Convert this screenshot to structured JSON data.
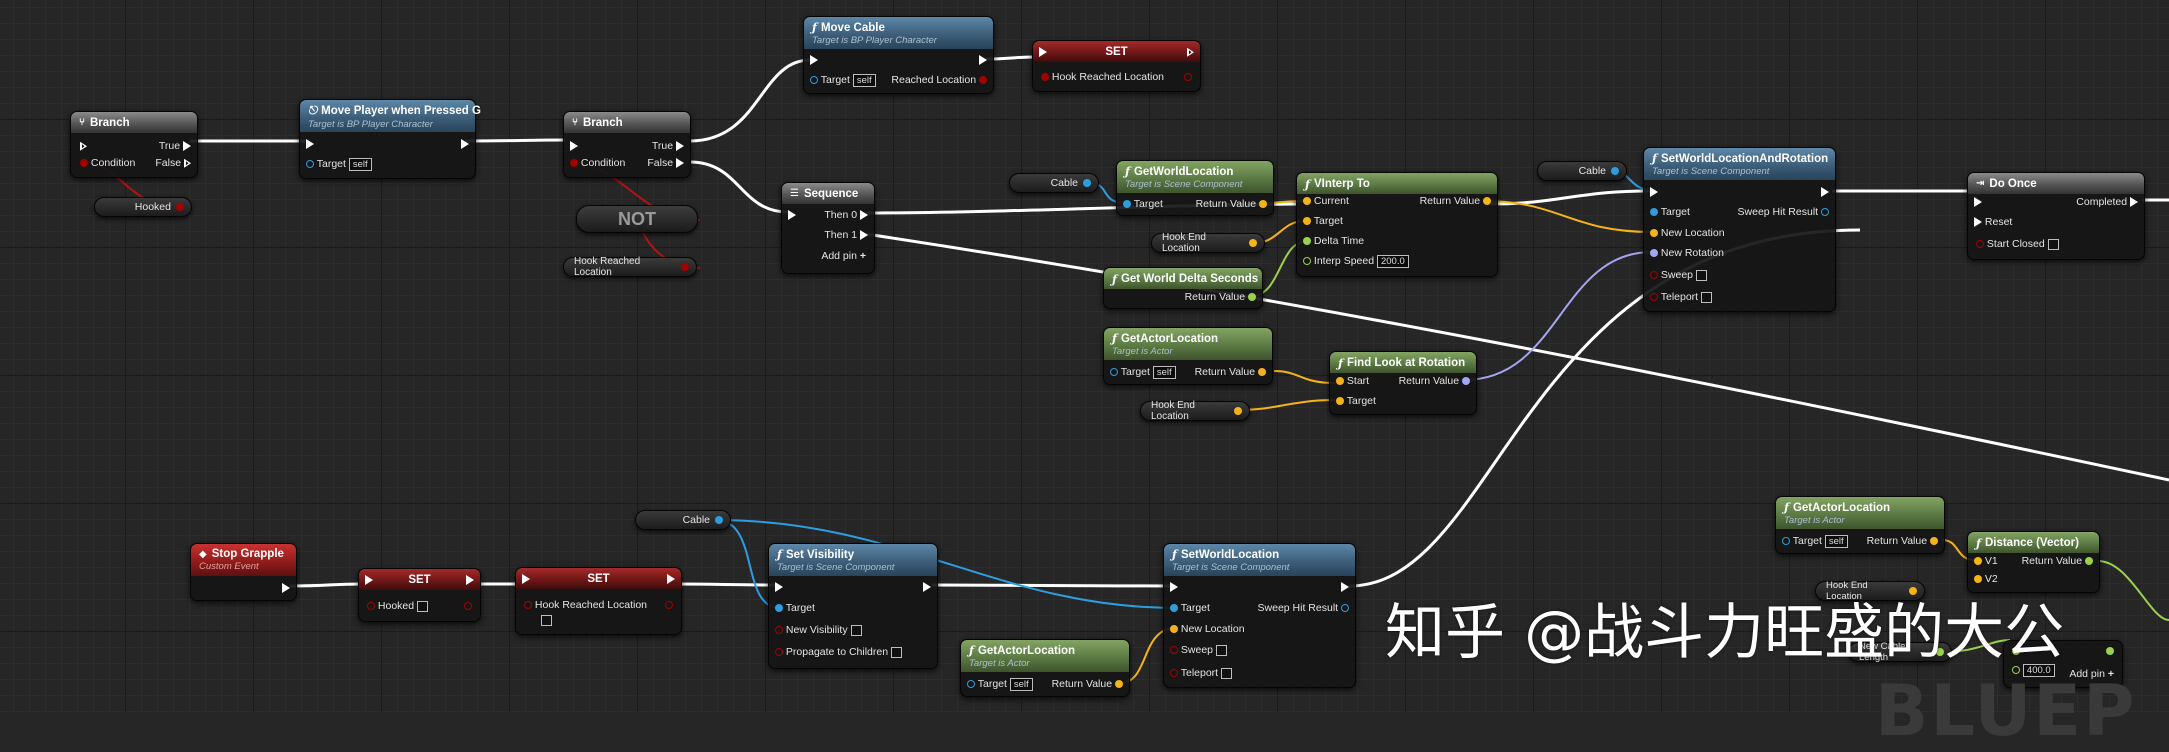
{
  "colors": {
    "exec": "#ffffff",
    "object": "#2e9de0",
    "vector": "#f5b31a",
    "float": "#9bd24c",
    "rotator": "#a3a6f0",
    "bool": "#a30000",
    "struct": "#7aa0ff"
  },
  "nodes": {
    "branch1": {
      "title": "Branch",
      "condition": "Condition",
      "true": "True",
      "false": "False"
    },
    "hooked_get": {
      "label": "Hooked"
    },
    "move_player": {
      "title": "Move Player when Pressed G",
      "subtitle": "Target is BP Player Character",
      "target": "Target",
      "self": "self"
    },
    "branch2": {
      "title": "Branch",
      "condition": "Condition",
      "true": "True",
      "false": "False"
    },
    "not_node": {
      "label": "NOT"
    },
    "hook_reached_get": {
      "label": "Hook Reached Location"
    },
    "move_cable": {
      "title": "Move Cable",
      "subtitle": "Target is BP Player Character",
      "target": "Target",
      "self": "self",
      "out": "Reached Location"
    },
    "set_top": {
      "title": "SET",
      "pin": "Hook Reached Location"
    },
    "sequence": {
      "title": "Sequence",
      "then0": "Then 0",
      "then1": "Then 1",
      "add": "Add pin"
    },
    "cable_get1": {
      "label": "Cable"
    },
    "get_world_location": {
      "title": "GetWorldLocation",
      "subtitle": "Target is Scene Component",
      "target": "Target",
      "ret": "Return Value"
    },
    "vinterp": {
      "title": "VInterp To",
      "current": "Current",
      "target": "Target",
      "delta": "Delta Time",
      "speed": "Interp Speed",
      "speed_val": "200.0",
      "ret": "Return Value"
    },
    "hook_end_get1": {
      "label": "Hook End Location"
    },
    "get_delta": {
      "title": "Get World Delta Seconds",
      "ret": "Return Value"
    },
    "cable_get2": {
      "label": "Cable"
    },
    "set_wlr": {
      "title": "SetWorldLocationAndRotation",
      "subtitle": "Target is Scene Component",
      "target": "Target",
      "newloc": "New Location",
      "newrot": "New Rotation",
      "sweep": "Sweep",
      "teleport": "Teleport",
      "ret": "Sweep Hit Result"
    },
    "get_actor_loc1": {
      "title": "GetActorLocation",
      "subtitle": "Target is Actor",
      "target": "Target",
      "self": "self",
      "ret": "Return Value"
    },
    "find_look": {
      "title": "Find Look at Rotation",
      "start": "Start",
      "target": "Target",
      "ret": "Return Value"
    },
    "hook_end_get2": {
      "label": "Hook End Location"
    },
    "do_once": {
      "title": "Do Once",
      "reset": "Reset",
      "closed": "Start Closed",
      "completed": "Completed"
    },
    "stop_grapple": {
      "title": "Stop Grapple",
      "subtitle": "Custom Event"
    },
    "set_hooked": {
      "title": "SET",
      "pin": "Hooked"
    },
    "set_hrl": {
      "title": "SET",
      "pin": "Hook Reached Location"
    },
    "cable_get3": {
      "label": "Cable"
    },
    "set_visibility": {
      "title": "Set Visibility",
      "subtitle": "Target is Scene Component",
      "target": "Target",
      "newvis": "New Visibility",
      "propagate": "Propagate to Children"
    },
    "get_actor_loc2": {
      "title": "GetActorLocation",
      "subtitle": "Target is Actor",
      "target": "Target",
      "self": "self",
      "ret": "Return Value"
    },
    "set_world_loc": {
      "title": "SetWorldLocation",
      "subtitle": "Target is Scene Component",
      "target": "Target",
      "newloc": "New Location",
      "sweep": "Sweep",
      "teleport": "Teleport",
      "ret": "Sweep Hit Result"
    },
    "get_actor_loc3": {
      "title": "GetActorLocation",
      "subtitle": "Target is Actor",
      "target": "Target",
      "self": "self",
      "ret": "Return Value"
    },
    "distance": {
      "title": "Distance (Vector)",
      "v1": "V1",
      "v2": "V2",
      "ret": "Return Value"
    },
    "hook_end_get3": {
      "label": "Hook End Location"
    },
    "new_cable_len": {
      "label": "New Cable Length"
    },
    "compare": {
      "value": "400.0",
      "add": "Add pin"
    }
  },
  "watermark": "知乎 @战斗力旺盛的大公",
  "background_text": "BLUEP"
}
